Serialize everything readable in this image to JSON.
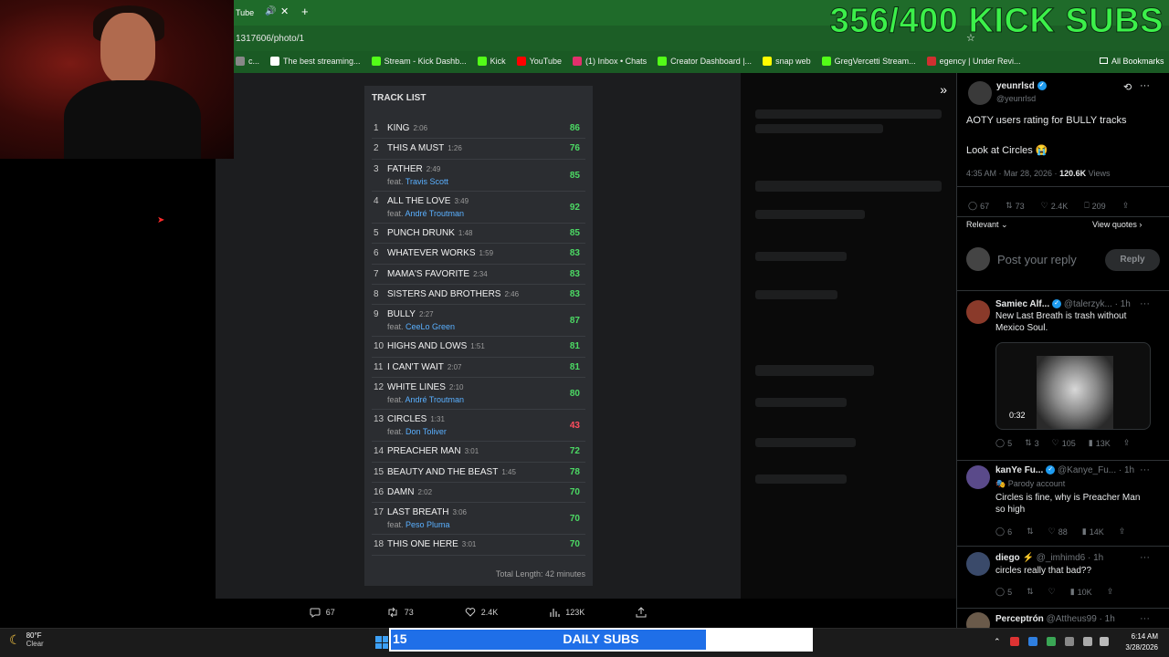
{
  "browser": {
    "tab_title": "Tube",
    "address_fragment": "1317606/photo/1",
    "bookmarks": [
      {
        "label": "c...",
        "color": "#888888"
      },
      {
        "label": "The best streaming...",
        "color": "#ffffff"
      },
      {
        "label": "Stream - Kick Dashb...",
        "color": "#53fc18"
      },
      {
        "label": "Kick",
        "color": "#53fc18"
      },
      {
        "label": "YouTube",
        "color": "#ff0000"
      },
      {
        "label": "(1) Inbox • Chats",
        "color": "#e1306c"
      },
      {
        "label": "Creator Dashboard |...",
        "color": "#53fc18"
      },
      {
        "label": "snap web",
        "color": "#fffc00"
      },
      {
        "label": "GregVercetti Stream...",
        "color": "#53fc18"
      },
      {
        "label": "egency | Under Revi...",
        "color": "#d03030"
      }
    ],
    "all_bookmarks": "All Bookmarks"
  },
  "overlay": {
    "subs_goal": "356/400 KICK SUBS"
  },
  "tracklist": {
    "title": "TRACK LIST",
    "total": "Total Length: 42 minutes",
    "tracks": [
      {
        "num": "1",
        "name": "KING",
        "length": "2:06",
        "feat": "",
        "artist": "",
        "score": "86",
        "color": "#4cd964"
      },
      {
        "num": "2",
        "name": "THIS A MUST",
        "length": "1:26",
        "feat": "",
        "artist": "",
        "score": "76",
        "color": "#4cd964"
      },
      {
        "num": "3",
        "name": "FATHER",
        "length": "2:49",
        "feat": "feat.",
        "artist": "Travis Scott",
        "score": "85",
        "color": "#4cd964"
      },
      {
        "num": "4",
        "name": "ALL THE LOVE",
        "length": "3:49",
        "feat": "feat.",
        "artist": "André Troutman",
        "score": "92",
        "color": "#4cd964"
      },
      {
        "num": "5",
        "name": "PUNCH DRUNK",
        "length": "1:48",
        "feat": "",
        "artist": "",
        "score": "85",
        "color": "#4cd964"
      },
      {
        "num": "6",
        "name": "WHATEVER WORKS",
        "length": "1:59",
        "feat": "",
        "artist": "",
        "score": "83",
        "color": "#4cd964"
      },
      {
        "num": "7",
        "name": "MAMA'S FAVORITE",
        "length": "2:34",
        "feat": "",
        "artist": "",
        "score": "83",
        "color": "#4cd964"
      },
      {
        "num": "8",
        "name": "SISTERS AND BROTHERS",
        "length": "2:46",
        "feat": "",
        "artist": "",
        "score": "83",
        "color": "#4cd964"
      },
      {
        "num": "9",
        "name": "BULLY",
        "length": "2:27",
        "feat": "feat.",
        "artist": "CeeLo Green",
        "score": "87",
        "color": "#4cd964"
      },
      {
        "num": "10",
        "name": "HIGHS AND LOWS",
        "length": "1:51",
        "feat": "",
        "artist": "",
        "score": "81",
        "color": "#4cd964"
      },
      {
        "num": "11",
        "name": "I CAN'T WAIT",
        "length": "2:07",
        "feat": "",
        "artist": "",
        "score": "81",
        "color": "#4cd964"
      },
      {
        "num": "12",
        "name": "WHITE LINES",
        "length": "2:10",
        "feat": "feat.",
        "artist": "André Troutman",
        "score": "80",
        "color": "#4cd964"
      },
      {
        "num": "13",
        "name": "CIRCLES",
        "length": "1:31",
        "feat": "feat.",
        "artist": "Don Toliver",
        "score": "43",
        "color": "#ff4d5e"
      },
      {
        "num": "14",
        "name": "PREACHER MAN",
        "length": "3:01",
        "feat": "",
        "artist": "",
        "score": "72",
        "color": "#4cd964"
      },
      {
        "num": "15",
        "name": "BEAUTY AND THE BEAST",
        "length": "1:45",
        "feat": "",
        "artist": "",
        "score": "78",
        "color": "#4cd964"
      },
      {
        "num": "16",
        "name": "DAMN",
        "length": "2:02",
        "feat": "",
        "artist": "",
        "score": "70",
        "color": "#4cd964"
      },
      {
        "num": "17",
        "name": "LAST BREATH",
        "length": "3:06",
        "feat": "feat.",
        "artist": "Peso Pluma",
        "score": "70",
        "color": "#4cd964"
      },
      {
        "num": "18",
        "name": "THIS ONE HERE",
        "length": "3:01",
        "feat": "",
        "artist": "",
        "score": "70",
        "color": "#4cd964"
      }
    ]
  },
  "photo_actions": {
    "replies": "67",
    "reposts": "73",
    "likes": "2.4K",
    "views": "123K"
  },
  "tweet": {
    "author": "yeunrlsd",
    "handle": "@yeunrlsd",
    "text1": "AOTY users rating for BULLY tracks",
    "text2": "Look at Circles 😭",
    "time": "4:35 AM · Mar 28, 2026 ·",
    "views_count": "120.6K",
    "views_label": "Views",
    "replies": "67",
    "reposts": "73",
    "likes": "2.4K",
    "bookmarks": "209",
    "sort": "Relevant",
    "view_quotes": "View quotes",
    "reply_placeholder": "Post your reply",
    "reply_button": "Reply"
  },
  "replies": [
    {
      "name": "Samiec Alf...",
      "handle": "@talerzyk...",
      "time": "· 1h",
      "badge": "",
      "text": "New Last Breath is trash without",
      "text2": "Mexico Soul.",
      "video_time": "0:32",
      "replies": "5",
      "reposts": "3",
      "likes": "105",
      "views": "13K"
    },
    {
      "name": "kanYe Fu...",
      "handle": "@Kanye_Fu...",
      "time": "· 1h",
      "badge": "Parody account",
      "text": "Circles is fine, why is Preacher Man",
      "text2": "so high",
      "replies": "6",
      "reposts": "",
      "likes": "88",
      "views": "14K"
    },
    {
      "name": "diego ⚡",
      "handle": "@_imhimd6",
      "time": "· 1h",
      "badge": "",
      "text": "circles really that bad??",
      "text2": "",
      "replies": "5",
      "reposts": "",
      "likes": "",
      "views": "10K"
    },
    {
      "name": "Perceptrón",
      "handle": "@Attheus99",
      "time": "· 1h",
      "badge": "",
      "text": "",
      "text2": ""
    }
  ],
  "taskbar": {
    "weather_temp": "80°F",
    "weather_cond": "Clear",
    "time": "6:14 AM",
    "date": "3/28/2026"
  },
  "daily_subs": {
    "current": "15",
    "label": "DAILY SUBS",
    "goal": "20",
    "progress": 0.75
  }
}
